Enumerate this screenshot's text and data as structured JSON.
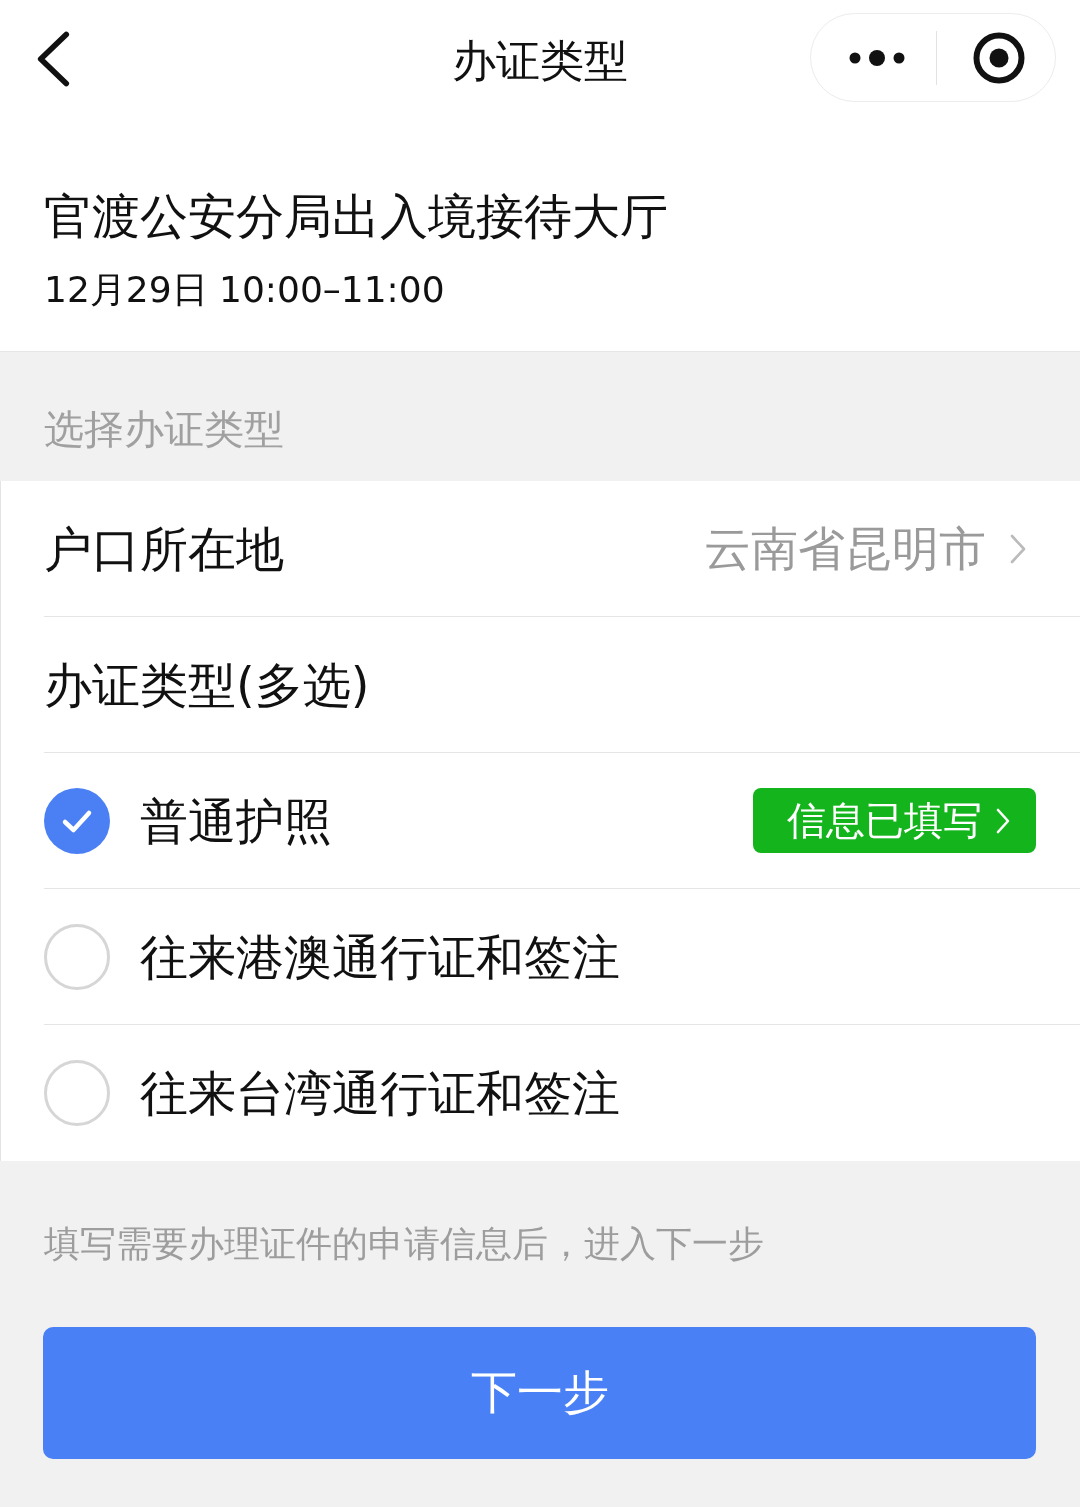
{
  "nav": {
    "title": "办证类型"
  },
  "appointment": {
    "venue": "官渡公安分局出入境接待大厅",
    "time": "12月29日 10:00–11:00"
  },
  "section_label": "选择办证类型",
  "residence": {
    "label": "户口所在地",
    "value": "云南省昆明市"
  },
  "type_heading": "办证类型(多选)",
  "options": [
    {
      "label": "普通护照",
      "checked": true,
      "badge": "信息已填写"
    },
    {
      "label": "往来港澳通行证和签注",
      "checked": false
    },
    {
      "label": "往来台湾通行证和签注",
      "checked": false
    }
  ],
  "hint": "填写需要办理证件的申请信息后，进入下一步",
  "primary_button": "下一步"
}
